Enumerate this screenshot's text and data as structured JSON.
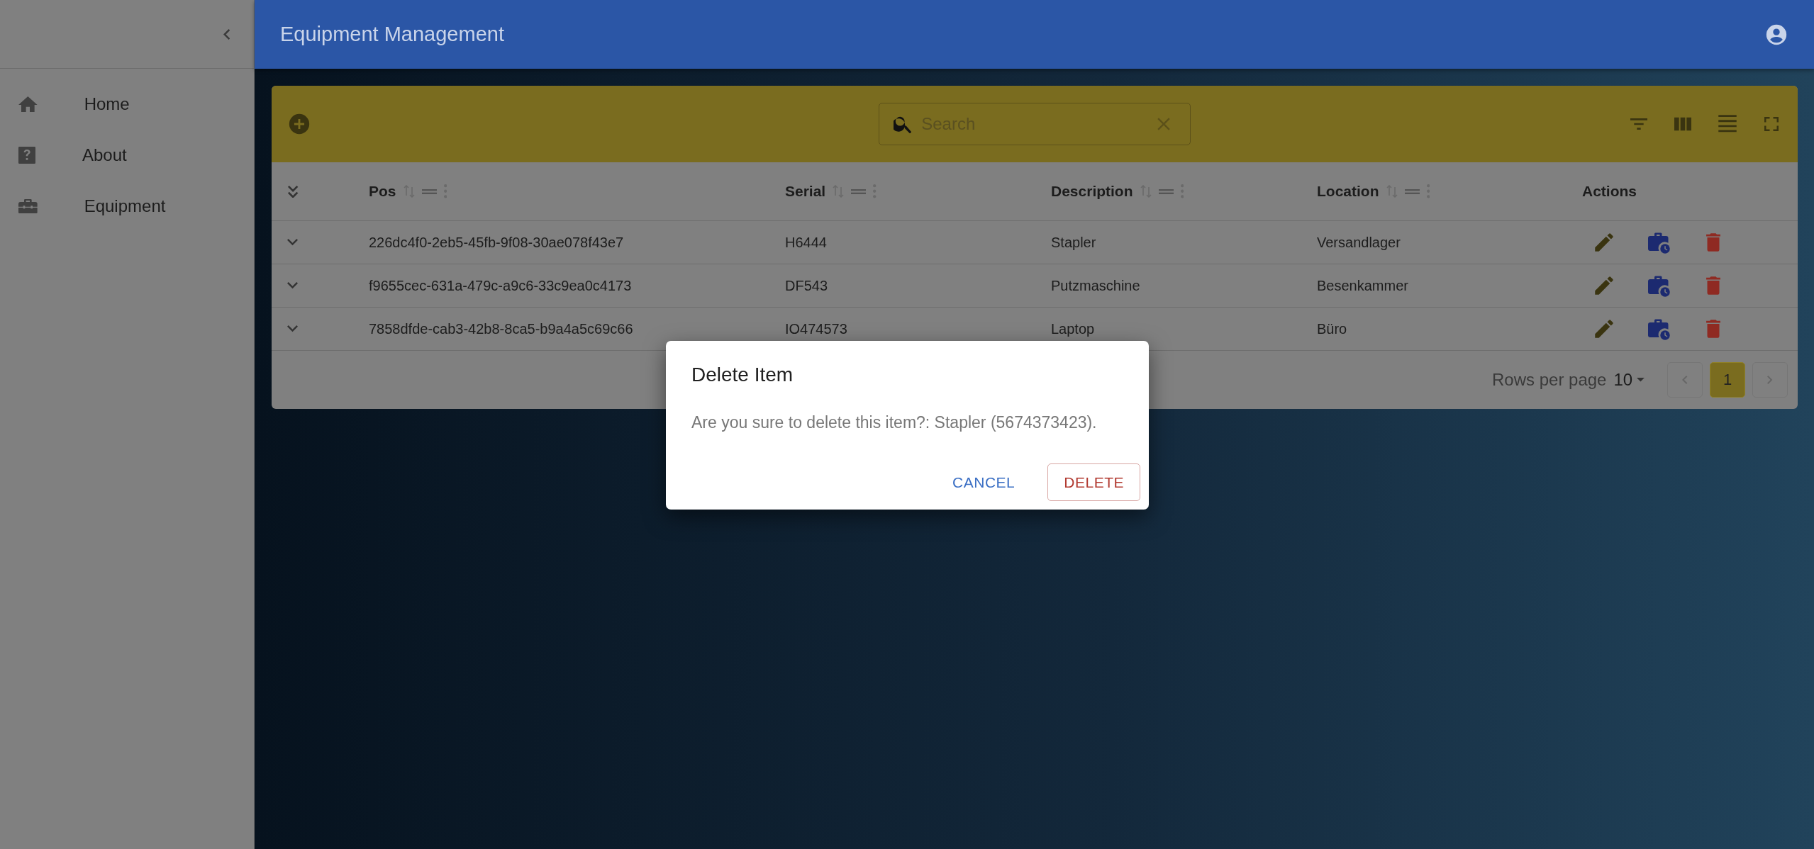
{
  "sidebar": {
    "items": [
      {
        "label": "Home"
      },
      {
        "label": "About"
      },
      {
        "label": "Equipment"
      }
    ]
  },
  "app_bar": {
    "title": "Equipment Management"
  },
  "toolbar": {
    "search": {
      "placeholder": "Search"
    }
  },
  "table": {
    "columns": [
      {
        "label": "Pos",
        "sortable": true
      },
      {
        "label": "Serial",
        "sortable": true
      },
      {
        "label": "Description",
        "sortable": true
      },
      {
        "label": "Location",
        "sortable": true
      },
      {
        "label": "Actions",
        "sortable": false
      }
    ],
    "rows": [
      {
        "cells": [
          "226dc4f0-2eb5-45fb-9f08-30ae078f43e7",
          "H6444",
          "Stapler",
          "Versandlager"
        ]
      },
      {
        "cells": [
          "f9655cec-631a-479c-a9c6-33c9ea0c4173",
          "DF543",
          "Putzmaschine",
          "Besenkammer"
        ]
      },
      {
        "cells": [
          "7858dfde-cab3-42b8-8ca5-b9a4a5c69c66",
          "IO474573",
          "Laptop",
          "Büro"
        ]
      }
    ]
  },
  "pagination": {
    "rows_per_page_label": "Rows per page",
    "rows_per_page": "10",
    "pages": [
      {
        "label": "1",
        "selected": true
      }
    ]
  },
  "dialog": {
    "title": "Delete Item",
    "message": "Are you sure to delete this item?: Stapler (5674373423).",
    "buttons": [
      {
        "label": "CANCEL",
        "kind": "text"
      },
      {
        "label": "DELETE",
        "kind": "outlined"
      }
    ]
  }
}
